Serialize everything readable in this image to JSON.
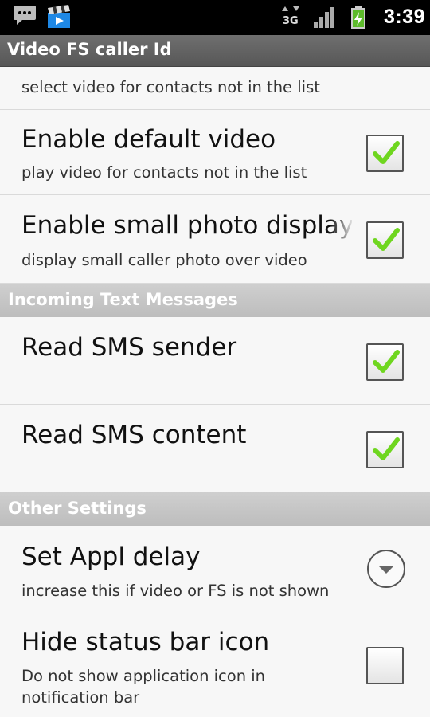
{
  "status_bar": {
    "time": "3:39",
    "network_label": "3G",
    "icons": [
      "chat-icon",
      "clapperboard-icon",
      "network-3g-icon",
      "signal-icon",
      "battery-charging-icon"
    ]
  },
  "title_bar": {
    "title": "Video FS caller Id"
  },
  "preferences": {
    "partial_top": {
      "summary": "select video for contacts not in the list"
    },
    "enable_default_video": {
      "title": "Enable default video",
      "summary": "play video for contacts not in the list",
      "checked": true
    },
    "enable_small_photo": {
      "title": "Enable small photo display",
      "summary": "display small caller photo over video",
      "checked": true
    },
    "read_sms_sender": {
      "title": "Read SMS sender",
      "checked": true
    },
    "read_sms_content": {
      "title": "Read SMS content",
      "checked": true
    },
    "set_appl_delay": {
      "title": "Set Appl delay",
      "summary": "increase this if video or FS is not shown"
    },
    "hide_status_bar_icon": {
      "title": "Hide status bar icon",
      "summary_line1": "Do not show application icon in",
      "summary_line2": "notification bar",
      "checked": false
    }
  },
  "categories": {
    "incoming_text": "Incoming Text Messages",
    "other_settings": "Other Settings"
  },
  "colors": {
    "check_green": "#6fd61f",
    "category_bg": "#c6c6c6",
    "title_bar_bg": "#636363"
  }
}
